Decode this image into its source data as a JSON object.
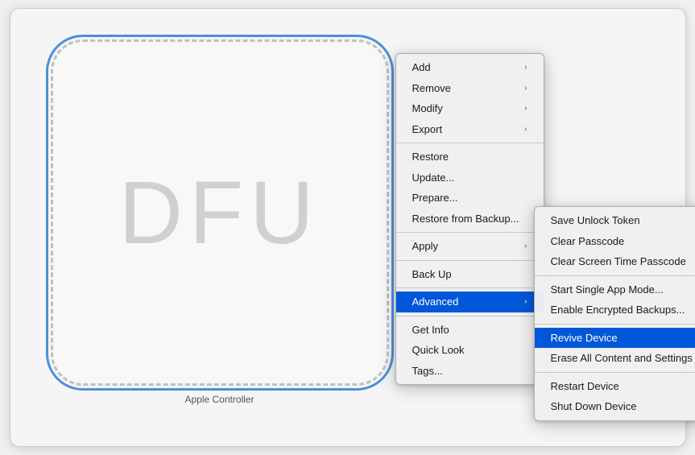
{
  "device": {
    "label": "Apple Controller",
    "dfu_text": "DFU"
  },
  "primary_menu": {
    "items": [
      {
        "id": "add",
        "label": "Add",
        "has_submenu": true
      },
      {
        "id": "remove",
        "label": "Remove",
        "has_submenu": true
      },
      {
        "id": "modify",
        "label": "Modify",
        "has_submenu": true
      },
      {
        "id": "export",
        "label": "Export",
        "has_submenu": true
      },
      {
        "id": "sep1",
        "type": "separator"
      },
      {
        "id": "restore",
        "label": "Restore",
        "has_submenu": false
      },
      {
        "id": "update",
        "label": "Update...",
        "has_submenu": false
      },
      {
        "id": "prepare",
        "label": "Prepare...",
        "has_submenu": false
      },
      {
        "id": "restore_backup",
        "label": "Restore from Backup...",
        "has_submenu": false
      },
      {
        "id": "sep2",
        "type": "separator"
      },
      {
        "id": "apply",
        "label": "Apply",
        "has_submenu": true
      },
      {
        "id": "sep3",
        "type": "separator"
      },
      {
        "id": "back_up",
        "label": "Back Up",
        "has_submenu": false
      },
      {
        "id": "sep4",
        "type": "separator"
      },
      {
        "id": "advanced",
        "label": "Advanced",
        "has_submenu": true,
        "highlighted": true
      },
      {
        "id": "sep5",
        "type": "separator"
      },
      {
        "id": "get_info",
        "label": "Get Info",
        "has_submenu": false
      },
      {
        "id": "quick_look",
        "label": "Quick Look",
        "has_submenu": false
      },
      {
        "id": "tags",
        "label": "Tags...",
        "has_submenu": false
      }
    ]
  },
  "submenu": {
    "items": [
      {
        "id": "save_unlock",
        "label": "Save Unlock Token",
        "has_submenu": false
      },
      {
        "id": "clear_passcode",
        "label": "Clear Passcode",
        "has_submenu": false
      },
      {
        "id": "clear_screen_time",
        "label": "Clear Screen Time Passcode",
        "has_submenu": false
      },
      {
        "id": "sep1",
        "type": "separator"
      },
      {
        "id": "single_app",
        "label": "Start Single App Mode...",
        "has_submenu": false
      },
      {
        "id": "encrypted_backups",
        "label": "Enable Encrypted Backups...",
        "has_submenu": false
      },
      {
        "id": "sep2",
        "type": "separator"
      },
      {
        "id": "revive",
        "label": "Revive Device",
        "has_submenu": false,
        "highlighted": true
      },
      {
        "id": "erase",
        "label": "Erase All Content and Settings",
        "has_submenu": false
      },
      {
        "id": "sep3",
        "type": "separator"
      },
      {
        "id": "restart",
        "label": "Restart Device",
        "has_submenu": false
      },
      {
        "id": "shutdown",
        "label": "Shut Down Device",
        "has_submenu": false
      }
    ]
  }
}
